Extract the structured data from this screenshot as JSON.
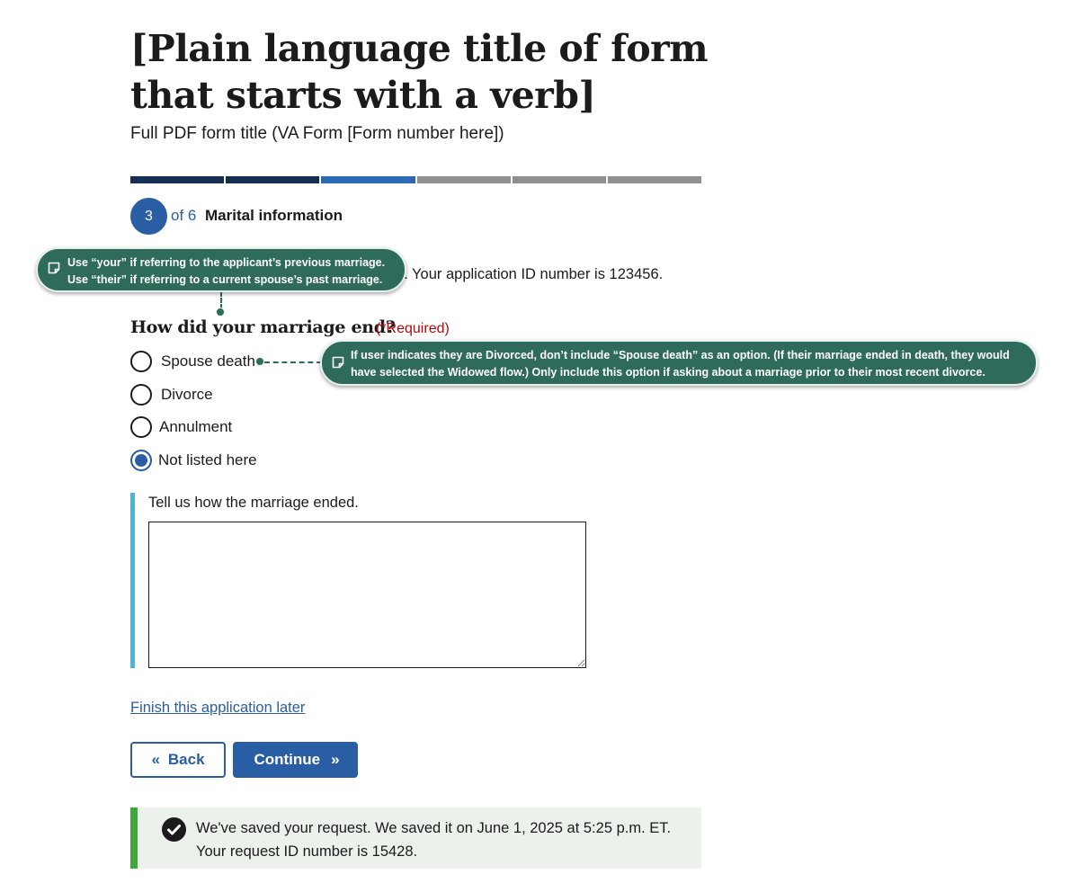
{
  "header": {
    "title": "[Plain language title of form that starts with a verb]",
    "subtitle": "Full PDF form title (VA Form [Form number here])"
  },
  "progress": {
    "total_segments": 6,
    "current_step": 3,
    "step_number": "3",
    "of_text": "of 6",
    "step_name": "Marital information"
  },
  "info_line": "e. Your application ID number is 123456.",
  "annotations": {
    "tip1_line1": "Use “your” if referring to the applicant’s previous marriage.",
    "tip1_line2": "Use “their” if referring to a current spouse’s past marriage.",
    "tip2_line1": "If user indicates they are Divorced, don’t include “Spouse death” as an option. (If their marriage ended in death, they would",
    "tip2_line2": "have selected the Widowed flow.) Only include this option if asking about a marriage prior to their most recent divorce.",
    "icon": "note-icon",
    "color": "#2f6b5b"
  },
  "question": {
    "label": "How did your marriage end?",
    "required": "(*Required)",
    "options": [
      {
        "label": "Spouse death",
        "checked": false
      },
      {
        "label": "Divorce",
        "checked": false
      },
      {
        "label": "Annulment",
        "checked": false
      },
      {
        "label": "Not listed here",
        "checked": true
      }
    ]
  },
  "followup": {
    "label": "Tell us how the marriage ended.",
    "value": ""
  },
  "links": {
    "finish_later": "Finish this application later"
  },
  "buttons": {
    "back": "Back",
    "continue": "Continue"
  },
  "alert": {
    "line1": "We've saved your request. We saved it on June 1, 2025 at 5:25 p.m. ET.",
    "line2": "Your request ID number is 15428.",
    "icon": "check-circle-icon",
    "color": "#3fa63a"
  },
  "colors": {
    "primary": "#2a5ea4",
    "progress_done": "#162e51",
    "progress_current": "#2e6bb5",
    "progress_todo": "#919191",
    "required": "#b50909",
    "followup_border": "#4db2dd"
  }
}
